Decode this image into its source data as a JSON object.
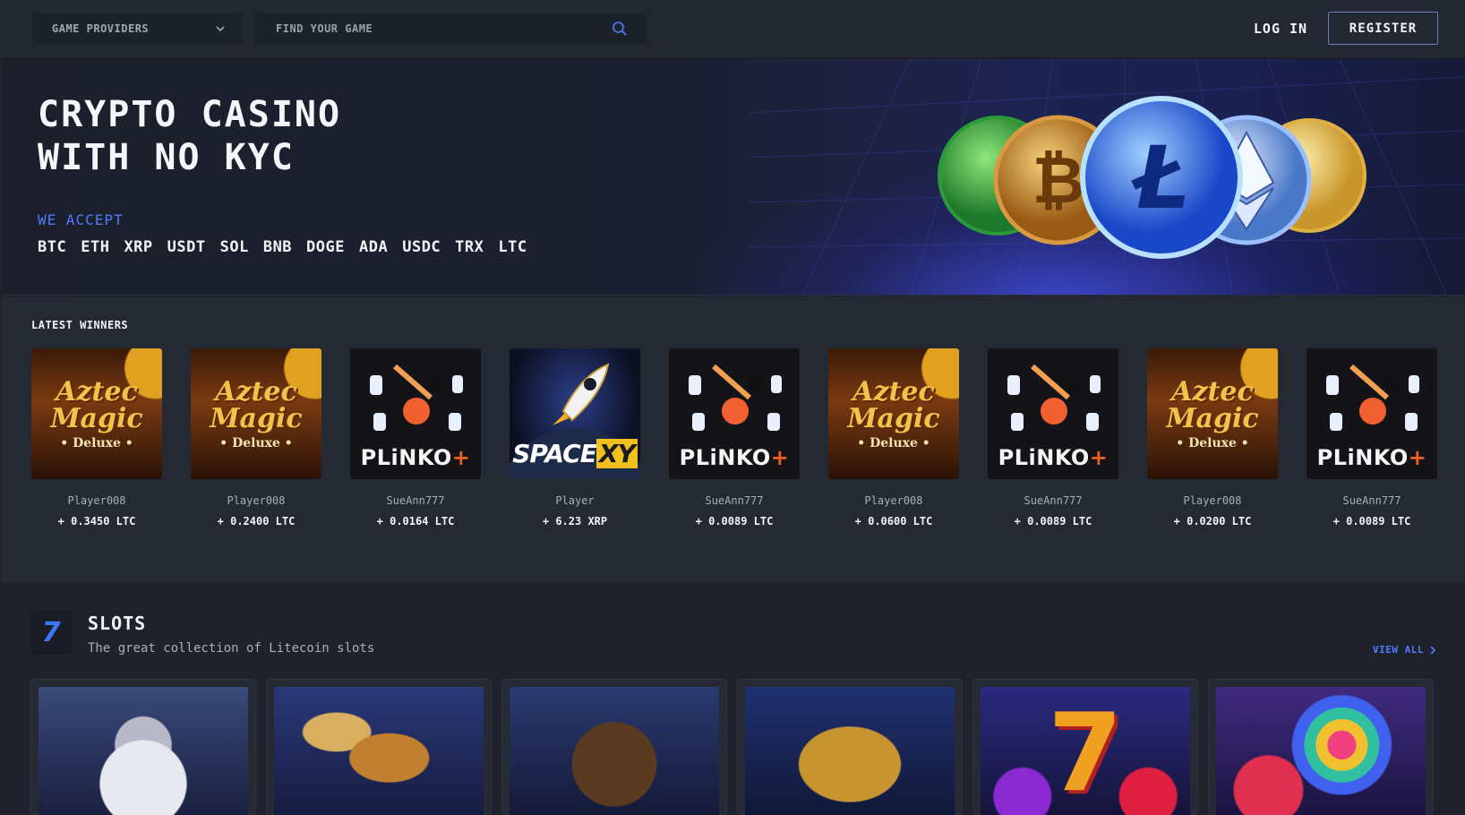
{
  "header": {
    "provider_select": "GAME PROVIDERS",
    "search_placeholder": "FIND YOUR GAME",
    "login_label": "LOG IN",
    "register_label": "REGISTER"
  },
  "hero": {
    "title_line1": "CRYPTO CASINO",
    "title_line2": "WITH NO KYC",
    "accept_label": "WE ACCEPT",
    "currencies": [
      "BTC",
      "ETH",
      "XRP",
      "USDT",
      "SOL",
      "BNB",
      "DOGE",
      "ADA",
      "USDC",
      "TRX",
      "LTC"
    ]
  },
  "winners": {
    "title": "LATEST WINNERS",
    "items": [
      {
        "game": "aztec",
        "art_line1": "Aztec",
        "art_line2": "Magic",
        "art_line3": "• Deluxe •",
        "player": "Player008",
        "amount": "+ 0.3450 LTC"
      },
      {
        "game": "aztec",
        "art_line1": "Aztec",
        "art_line2": "Magic",
        "art_line3": "• Deluxe •",
        "player": "Player008",
        "amount": "+ 0.2400 LTC"
      },
      {
        "game": "plinko",
        "art_line1": "PLiNKO",
        "art_line2": "+",
        "player": "SueAnn777",
        "amount": "+ 0.0164 LTC"
      },
      {
        "game": "space",
        "art_line1": "SPACE",
        "art_line2": "XY",
        "player": "Player",
        "amount": "+ 6.23 XRP"
      },
      {
        "game": "plinko",
        "art_line1": "PLiNKO",
        "art_line2": "+",
        "player": "SueAnn777",
        "amount": "+ 0.0089 LTC"
      },
      {
        "game": "aztec",
        "art_line1": "Aztec",
        "art_line2": "Magic",
        "art_line3": "• Deluxe •",
        "player": "Player008",
        "amount": "+ 0.0600 LTC"
      },
      {
        "game": "plinko",
        "art_line1": "PLiNKO",
        "art_line2": "+",
        "player": "SueAnn777",
        "amount": "+ 0.0089 LTC"
      },
      {
        "game": "aztec",
        "art_line1": "Aztec",
        "art_line2": "Magic",
        "art_line3": "• Deluxe •",
        "player": "Player008",
        "amount": "+ 0.0200 LTC"
      },
      {
        "game": "plinko",
        "art_line1": "PLiNKO",
        "art_line2": "+",
        "player": "SueAnn777",
        "amount": "+ 0.0089 LTC"
      }
    ]
  },
  "slots": {
    "icon_glyph": "7",
    "title": "SLOTS",
    "subtitle": "The great collection of Litecoin slots",
    "view_all": "VIEW ALL",
    "seven_glyph": "7"
  },
  "colors": {
    "accent_blue": "#4f7bff",
    "page_bg": "#1f222b",
    "panel_bg": "#252934",
    "plinko_plus": "#f06020",
    "space_xy_bg": "#f0c020"
  },
  "icons": {
    "provider_chevron": "chevron-down-icon",
    "search": "search-icon",
    "view_all_chevron": "chevron-right-icon"
  }
}
